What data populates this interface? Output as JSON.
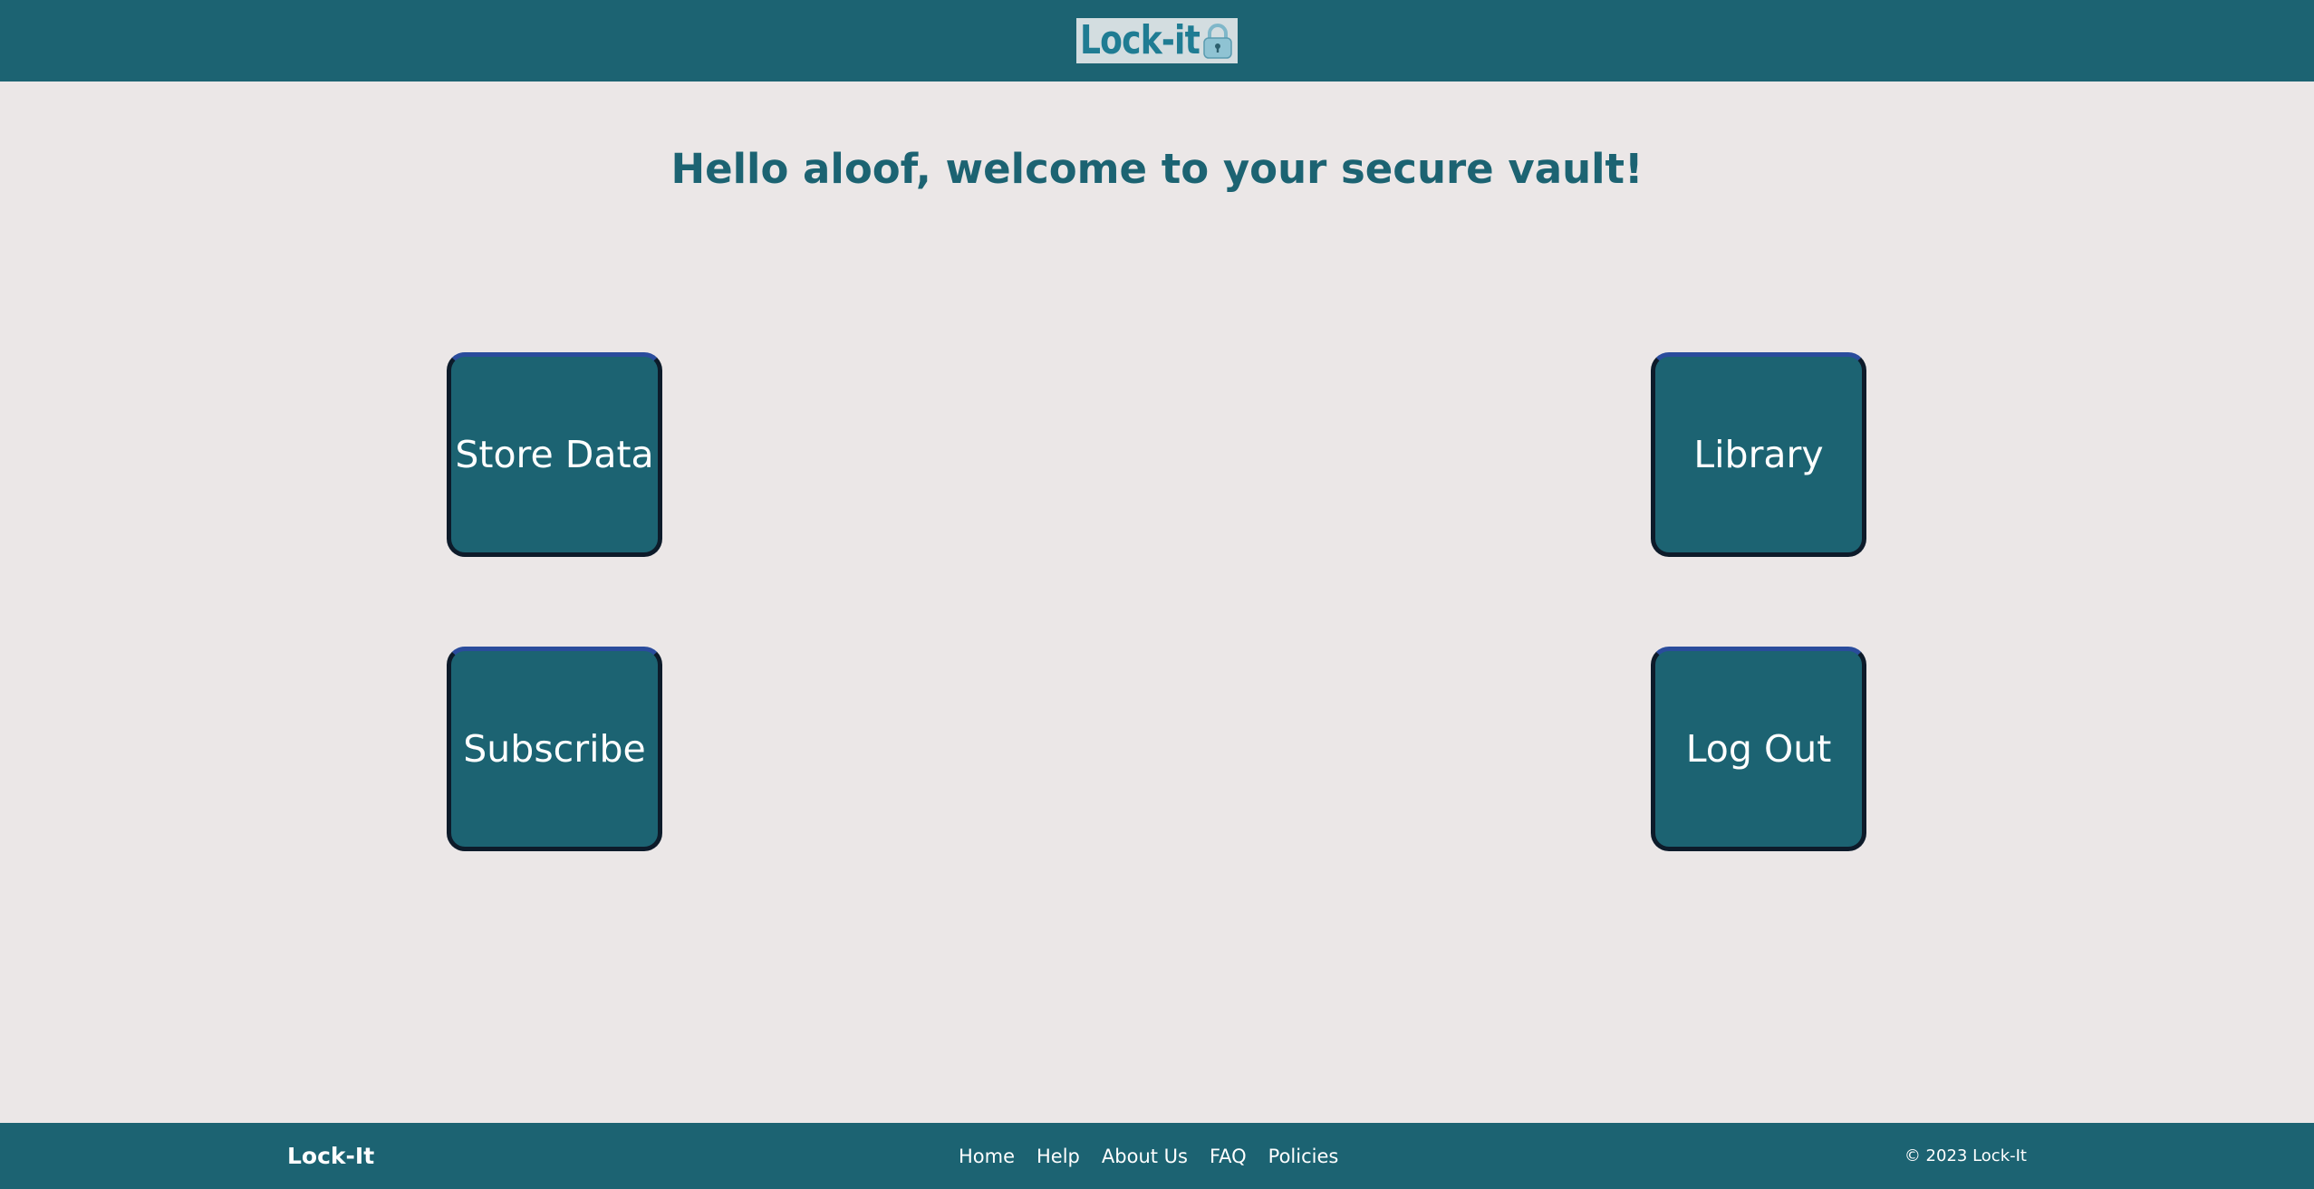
{
  "header": {
    "logo_text": "Lock-it",
    "logo_icon": "padlock-icon",
    "background": "#1c6372"
  },
  "main": {
    "welcome": "Hello aloof, welcome to your secure vault!",
    "tiles": [
      {
        "label": "Store Data"
      },
      {
        "label": "Library"
      },
      {
        "label": "Subscribe"
      },
      {
        "label": "Log Out"
      }
    ],
    "tile_color": "#1c6372",
    "tile_border_color": "#0d1b2a",
    "tile_accent_color": "#2f5bc4"
  },
  "footer": {
    "brand": "Lock-It",
    "links": [
      "Home",
      "Help",
      "About Us",
      "FAQ",
      "Policies"
    ],
    "copyright": "© 2023 Lock-It"
  },
  "colors": {
    "page_background": "#ebe7e7",
    "primary": "#1c6372",
    "text_light": "#ffffff"
  }
}
